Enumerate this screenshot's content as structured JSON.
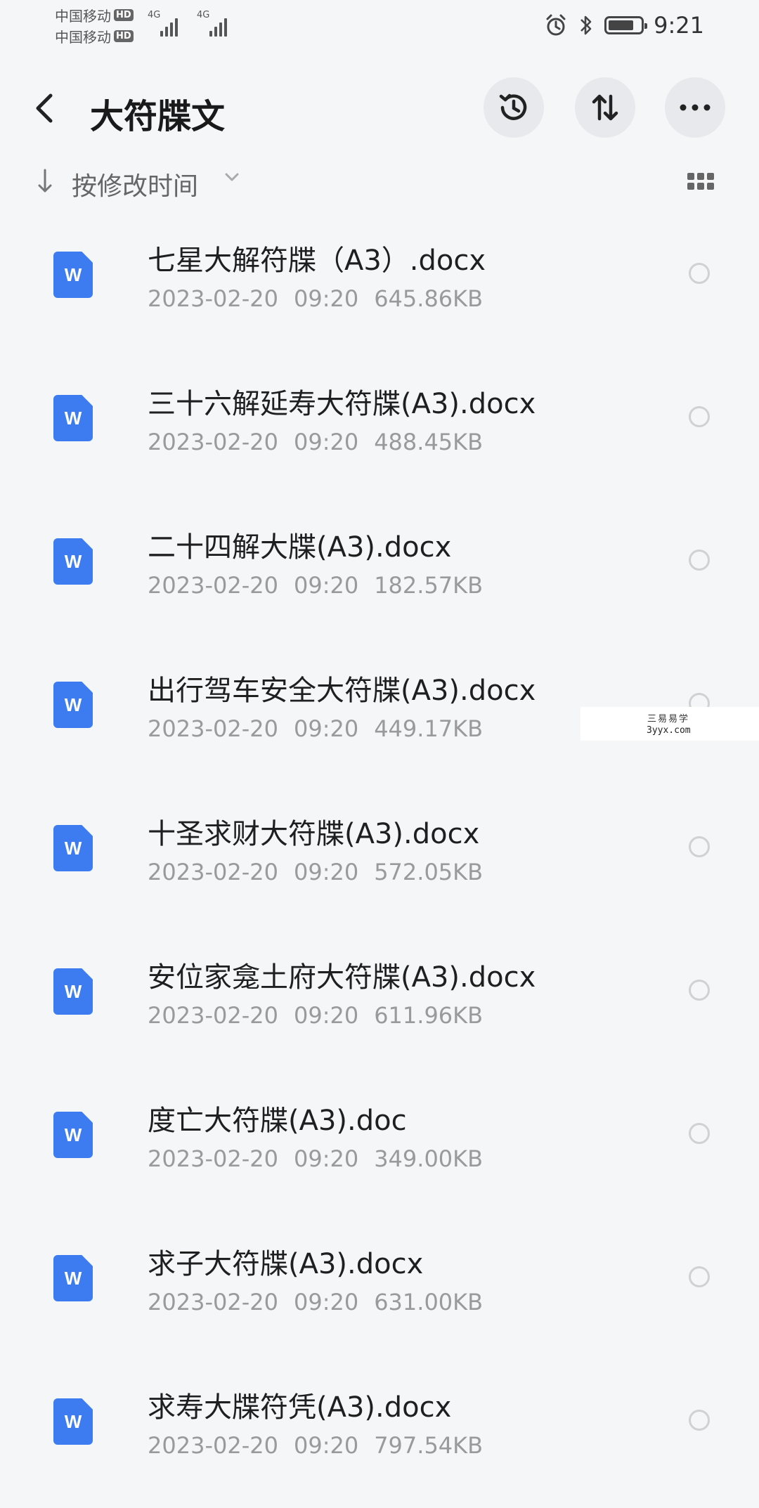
{
  "status": {
    "carrier1": "中国移动",
    "carrier2": "中国移动",
    "hd": "HD",
    "network1": "4G",
    "network2": "4G",
    "time": "9:21"
  },
  "header": {
    "title": "大符牒文"
  },
  "sort": {
    "label": "按修改时间"
  },
  "files": [
    {
      "name": "七星大解符牒（A3）.docx",
      "date": "2023-02-20",
      "time": "09:20",
      "size": "645.86KB"
    },
    {
      "name": "三十六解延寿大符牒(A3).docx",
      "date": "2023-02-20",
      "time": "09:20",
      "size": "488.45KB"
    },
    {
      "name": "二十四解大牒(A3).docx",
      "date": "2023-02-20",
      "time": "09:20",
      "size": "182.57KB"
    },
    {
      "name": "出行驾车安全大符牒(A3).docx",
      "date": "2023-02-20",
      "time": "09:20",
      "size": "449.17KB"
    },
    {
      "name": "十圣求财大符牒(A3).docx",
      "date": "2023-02-20",
      "time": "09:20",
      "size": "572.05KB"
    },
    {
      "name": "安位家龛土府大符牒(A3).docx",
      "date": "2023-02-20",
      "time": "09:20",
      "size": "611.96KB"
    },
    {
      "name": "度亡大符牒(A3).doc",
      "date": "2023-02-20",
      "time": "09:20",
      "size": "349.00KB"
    },
    {
      "name": "求子大符牒(A3).docx",
      "date": "2023-02-20",
      "time": "09:20",
      "size": "631.00KB"
    },
    {
      "name": "求寿大牒符凭(A3).docx",
      "date": "2023-02-20",
      "time": "09:20",
      "size": "797.54KB"
    }
  ],
  "file_icon_letter": "W",
  "watermark": {
    "cn": "三易易学",
    "en": "3yyx.com"
  },
  "colors": {
    "background": "#f5f6f8",
    "file_icon": "#3d7cf0",
    "title_text": "#1a1a1a",
    "meta_text": "#9a9a9a"
  }
}
